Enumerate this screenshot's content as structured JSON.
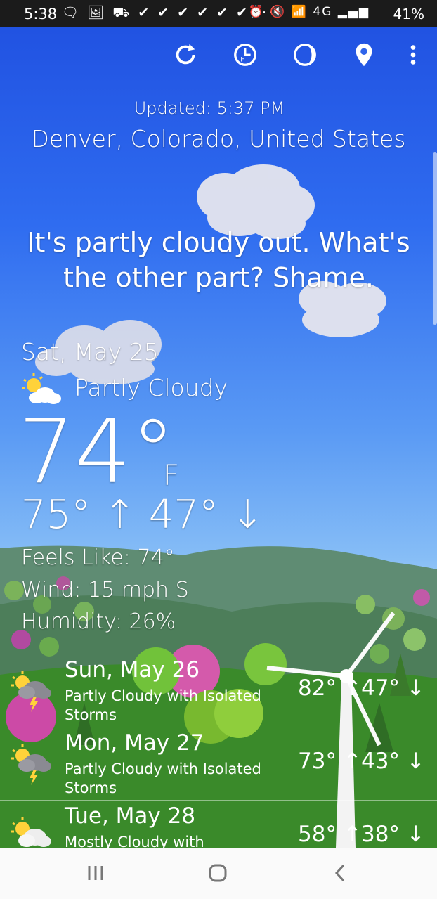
{
  "status_bar": {
    "time": "5:38",
    "notification_icons": "🗨 🖼 ⛟ ✔ ✔ ✔ ✔ ✔ ✔ ···",
    "system_icons": "⏰ 🔇 📶 4G ▂▄▆",
    "battery": "41%"
  },
  "toolbar": {
    "icons": [
      "refresh-icon",
      "history-icon",
      "moon-phase-icon",
      "location-pin-icon",
      "more-vert-icon"
    ]
  },
  "header": {
    "updated": "Updated: 5:37 PM",
    "location": "Denver, Colorado, United States"
  },
  "quip": "It's partly cloudy out. What's the other part? Shame.",
  "current": {
    "date": "Sat, May 25",
    "condition": "Partly Cloudy",
    "condition_icon": "partly-cloudy-icon",
    "temperature": "74°",
    "unit": "F",
    "high_low": "75° ↑ 47° ↓",
    "feels_like": "Feels Like: 74°",
    "wind": "Wind: 15 mph S",
    "humidity": "Humidity: 26%"
  },
  "forecast": [
    {
      "day": "Sun, May 26",
      "desc": "Partly Cloudy with Isolated Storms",
      "high": "82° ↑",
      "low": "47° ↓",
      "icon": "partly-cloudy-storm-icon"
    },
    {
      "day": "Mon, May 27",
      "desc": "Partly Cloudy with Isolated Storms",
      "high": "73° ↑",
      "low": "43° ↓",
      "icon": "partly-cloudy-storm-icon"
    },
    {
      "day": "Tue, May 28",
      "desc": "Mostly Cloudy with Scattered",
      "high": "58° ↑",
      "low": "38° ↓",
      "icon": "mostly-cloudy-icon"
    }
  ],
  "nav_bar": {
    "icons": [
      "recent-apps-icon",
      "home-icon",
      "back-icon"
    ]
  },
  "colors": {
    "sky_top": "#1f4fe0",
    "sky_bottom": "#9fcdf7",
    "grass": "#3d8a2c",
    "hills": "#5d8a6a"
  }
}
